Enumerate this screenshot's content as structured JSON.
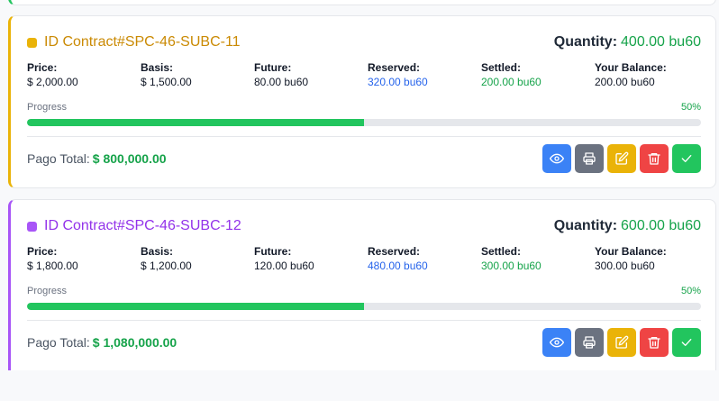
{
  "contracts": [
    {
      "title": "ID Contract#SPC-46-SUBC-11",
      "accent": "#eab308",
      "title_color": "#ca8a04",
      "quantity_label": "Quantity:",
      "quantity_value": "400.00 bu60",
      "stats": [
        {
          "label": "Price:",
          "value": "$ 2,000.00"
        },
        {
          "label": "Basis:",
          "value": "$ 1,500.00"
        },
        {
          "label": "Future:",
          "value": "80.00 bu60"
        },
        {
          "label": "Reserved:",
          "value": "320.00 bu60"
        },
        {
          "label": "Settled:",
          "value": "200.00 bu60"
        },
        {
          "label": "Your Balance:",
          "value": "200.00 bu60"
        }
      ],
      "progress_label": "Progress",
      "progress_pct": "50%",
      "progress_value": 0.5,
      "total_label": "Pago Total:",
      "total_value": "$ 800,000.00"
    },
    {
      "title": "ID Contract#SPC-46-SUBC-12",
      "accent": "#a855f7",
      "title_color": "#9333ea",
      "quantity_label": "Quantity:",
      "quantity_value": "600.00 bu60",
      "stats": [
        {
          "label": "Price:",
          "value": "$ 1,800.00"
        },
        {
          "label": "Basis:",
          "value": "$ 1,200.00"
        },
        {
          "label": "Future:",
          "value": "120.00 bu60"
        },
        {
          "label": "Reserved:",
          "value": "480.00 bu60"
        },
        {
          "label": "Settled:",
          "value": "300.00 bu60"
        },
        {
          "label": "Your Balance:",
          "value": "300.00 bu60"
        }
      ],
      "progress_label": "Progress",
      "progress_pct": "50%",
      "progress_value": 0.5,
      "total_label": "Pago Total:",
      "total_value": "$ 1,080,000.00"
    }
  ],
  "action_icons": [
    "eye-icon",
    "printer-icon",
    "edit-icon",
    "trash-icon",
    "check-icon"
  ]
}
